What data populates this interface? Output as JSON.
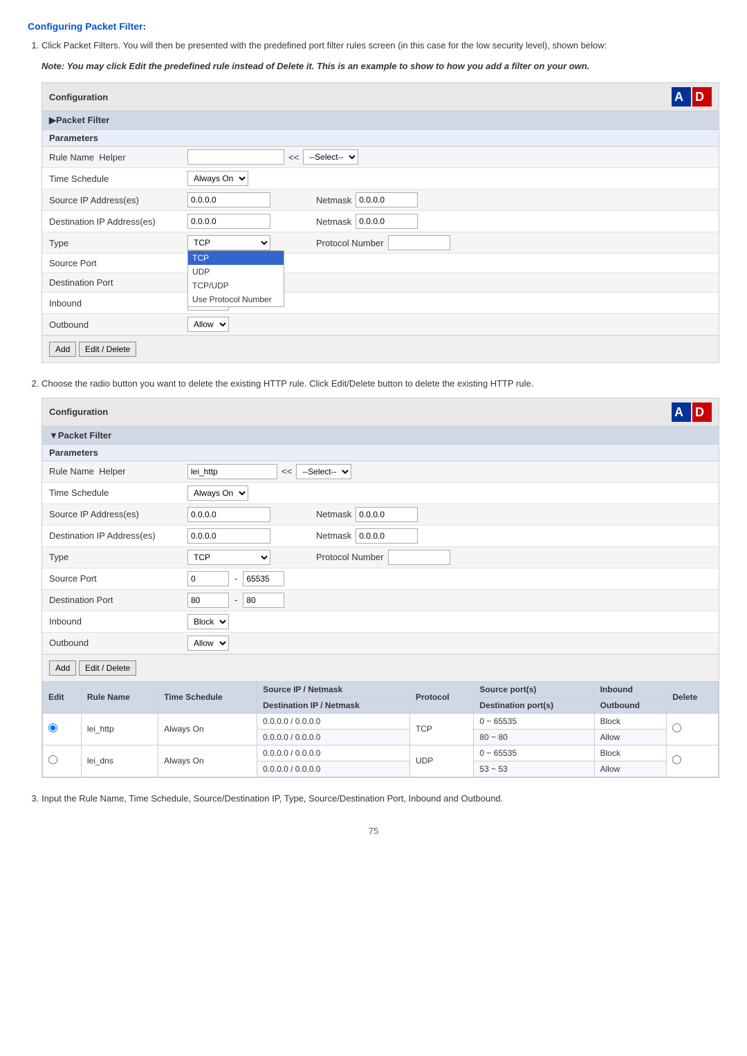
{
  "page": {
    "title": "Configuring Packet Filter:",
    "step1_text": "Click Packet Filters. You will then be presented with the predefined port filter rules screen (in this case for the low security level), shown below:",
    "note_text": "Note: You may click Edit the predefined rule instead of Delete it.  This is an example to show to how you add a filter on your own.",
    "step2_text": "Choose the radio button you want to delete the existing HTTP rule.  Click Edit/Delete button to delete the existing HTTP rule.",
    "step3_text": "Input the Rule Name, Time Schedule, Source/Destination IP, Type, Source/Destination Port, Inbound and Outbound.",
    "page_number": "75"
  },
  "config1": {
    "header": "Configuration",
    "packet_filter_label": "▶Packet Filter",
    "parameters_label": "Parameters",
    "fields": {
      "rule_name": "Rule Name",
      "rule_name_helper": "Helper",
      "rule_name_value": "",
      "rule_name_select_prefix": "<<",
      "rule_name_select": "--Select--",
      "time_schedule": "Time Schedule",
      "time_schedule_value": "Always On",
      "source_ip": "Source IP Address(es)",
      "source_ip_value": "0.0.0.0",
      "source_netmask": "Netmask",
      "source_netmask_value": "0.0.0.0",
      "dest_ip": "Destination IP Address(es)",
      "dest_ip_value": "0.0.0.0",
      "dest_netmask": "Netmask",
      "dest_netmask_value": "0.0.0.0",
      "type": "Type",
      "type_value": "TCP",
      "protocol_number": "Protocol Number",
      "protocol_number_value": "",
      "source_port": "Source Port",
      "dest_port": "Destination Port",
      "inbound": "Inbound",
      "inbound_value": "Allow",
      "outbound": "Outbound",
      "outbound_value": "Allow"
    },
    "dropdown": {
      "items": [
        "TCP",
        "UDP",
        "TCP/UDP",
        "Use Protocol Number"
      ],
      "selected": "TCP"
    },
    "buttons": {
      "add": "Add",
      "edit_delete": "Edit / Delete"
    }
  },
  "config2": {
    "header": "Configuration",
    "packet_filter_label": "▼Packet Filter",
    "parameters_label": "Parameters",
    "fields": {
      "rule_name": "Rule Name",
      "rule_name_helper": "Helper",
      "rule_name_value": "lei_http",
      "rule_name_select_prefix": "<<",
      "rule_name_select": "--Select--",
      "time_schedule": "Time Schedule",
      "time_schedule_value": "Always On",
      "source_ip": "Source IP Address(es)",
      "source_ip_value": "0.0.0.0",
      "source_netmask": "Netmask",
      "source_netmask_value": "0.0.0.0",
      "dest_ip": "Destination IP Address(es)",
      "dest_ip_value": "0.0.0.0",
      "dest_netmask": "Netmask",
      "dest_netmask_value": "0.0.0.0",
      "type": "Type",
      "type_value": "TCP",
      "protocol_number": "Protocol Number",
      "protocol_number_value": "",
      "source_port": "Source Port",
      "source_port_from": "0",
      "source_port_to": "65535",
      "dest_port": "Destination Port",
      "dest_port_from": "80",
      "dest_port_to": "80",
      "inbound": "Inbound",
      "inbound_value": "Block",
      "outbound": "Outbound",
      "outbound_value": "Allow"
    },
    "buttons": {
      "add": "Add",
      "edit_delete": "Edit / Delete"
    },
    "table": {
      "headers": {
        "edit": "Edit",
        "rule_name": "Rule Name",
        "time_schedule": "Time Schedule",
        "source_ip_netmask_top": "Source IP / Netmask",
        "dest_ip_netmask_bottom": "Destination IP / Netmask",
        "protocol": "Protocol",
        "source_port_top": "Source port(s)",
        "dest_port_bottom": "Destination port(s)",
        "inbound": "Inbound",
        "outbound": "Outbound",
        "delete": "Delete"
      },
      "rows": [
        {
          "radio": "selected",
          "rule_name": "lei_http",
          "time_schedule": "Always On",
          "source_ip": "0.0.0.0 / 0.0.0.0",
          "dest_ip": "0.0.0.0 / 0.0.0.0",
          "protocol": "TCP",
          "source_port": "0 ~ 65535",
          "dest_port": "80 ~ 80",
          "inbound": "Block",
          "outbound": "Allow"
        },
        {
          "radio": "",
          "rule_name": "lei_dns",
          "time_schedule": "Always On",
          "source_ip": "0.0.0.0 / 0.0.0.0",
          "dest_ip": "0.0.0.0 / 0.0.0.0",
          "protocol": "UDP",
          "source_port": "0 ~ 65535",
          "dest_port": "53 ~ 53",
          "inbound": "Block",
          "outbound": "Allow"
        }
      ]
    }
  }
}
